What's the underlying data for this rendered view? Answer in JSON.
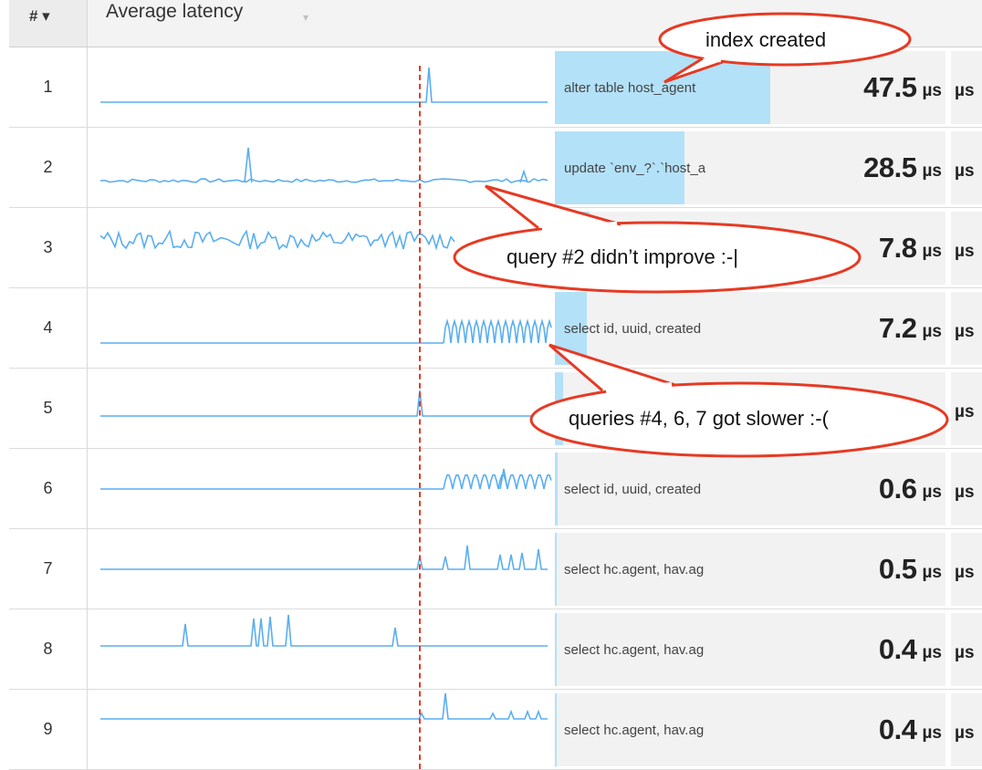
{
  "header": {
    "num_label": "# ▾",
    "title": "Average latency",
    "sort_caret": "▾"
  },
  "rows": [
    {
      "num": "1",
      "query": "alter table host_agent",
      "value": "47.5",
      "unit": "µs",
      "unit2": "µs",
      "bar_fraction": 1.0
    },
    {
      "num": "2",
      "query": "update `env_?`.`host_a",
      "value": "28.5",
      "unit": "µs",
      "unit2": "µs",
      "bar_fraction": 0.6
    },
    {
      "num": "3",
      "query": "",
      "value": "7.8",
      "unit": "µs",
      "unit2": "µs",
      "bar_fraction": 0.16
    },
    {
      "num": "4",
      "query": "select id, uuid, created",
      "value": "7.2",
      "unit": "µs",
      "unit2": "µs",
      "bar_fraction": 0.15
    },
    {
      "num": "5",
      "query": "",
      "value": "",
      "unit": "",
      "unit2": "µs",
      "bar_fraction": 0.04
    },
    {
      "num": "6",
      "query": "select id, uuid, created",
      "value": "0.6",
      "unit": "µs",
      "unit2": "µs",
      "bar_fraction": 0.012
    },
    {
      "num": "7",
      "query": "select hc.agent, hav.ag",
      "value": "0.5",
      "unit": "µs",
      "unit2": "µs",
      "bar_fraction": 0.01
    },
    {
      "num": "8",
      "query": "select hc.agent, hav.ag",
      "value": "0.4",
      "unit": "µs",
      "unit2": "µs",
      "bar_fraction": 0.008
    },
    {
      "num": "9",
      "query": "select hc.agent, hav.ag",
      "value": "0.4",
      "unit": "µs",
      "unit2": "µs",
      "bar_fraction": 0.008
    }
  ],
  "annotations": {
    "index_created": "index created",
    "query2": "query #2 didn’t improve :-|",
    "slower": "queries #4, 6, 7 got slower :-("
  },
  "colors": {
    "sparkline": "#5aaef0",
    "bar": "#b3e1f8",
    "annotation": "#e63a24"
  }
}
